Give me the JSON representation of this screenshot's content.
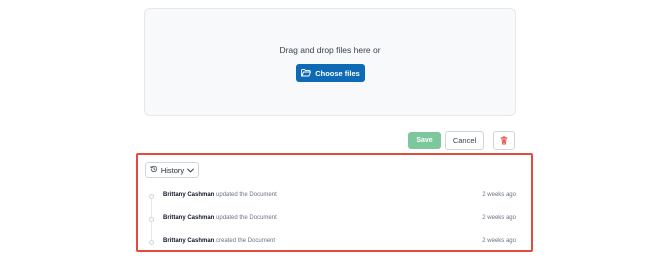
{
  "upload": {
    "prompt": "Drag and drop files here or",
    "choose_label": "Choose files"
  },
  "actions": {
    "save_label": "Save",
    "cancel_label": "Cancel",
    "delete_icon": "trash-icon"
  },
  "history": {
    "dropdown_label": "History",
    "items": [
      {
        "user": "Brittany Cashman",
        "action": "updated the Document",
        "time": "2 weeks ago"
      },
      {
        "user": "Brittany Cashman",
        "action": "updated the Document",
        "time": "2 weeks ago"
      },
      {
        "user": "Brittany Cashman",
        "action": "created the Document",
        "time": "2 weeks ago"
      }
    ]
  },
  "colors": {
    "primary": "#0e6ab5",
    "save": "#7cc79c",
    "danger": "#e14b40",
    "highlight_border": "#e14b40"
  }
}
